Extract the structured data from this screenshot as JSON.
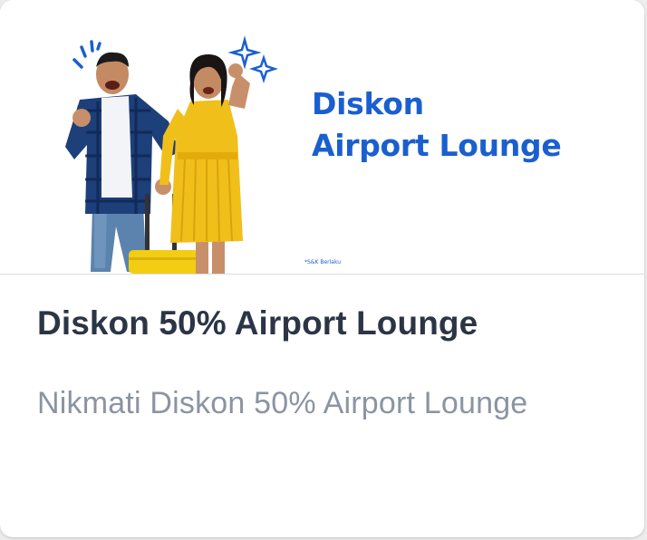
{
  "promo_card": {
    "banner": {
      "headline_line1": "Diskon",
      "headline_line2": "Airport Lounge",
      "disclaimer": "*S&K Berlaku",
      "illustration": "couple-traveling-with-suitcase-illustration",
      "accent_color": "#1a5fcf"
    },
    "title": "Diskon 50% Airport Lounge",
    "subtitle": "Nikmati Diskon 50% Airport Lounge"
  }
}
